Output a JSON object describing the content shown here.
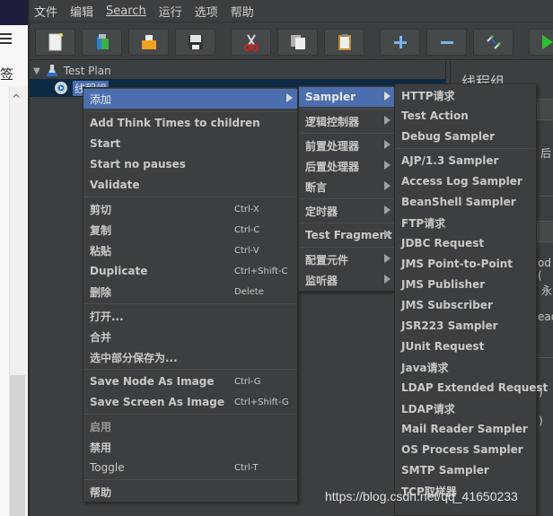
{
  "browser": {
    "side_char": "签",
    "scroll_up": "^"
  },
  "menubar": {
    "items": [
      "文件",
      "编辑",
      "Search",
      "运行",
      "选项",
      "帮助"
    ]
  },
  "toolbar": {
    "buttons": [
      "new",
      "templates",
      "open",
      "save",
      "cut",
      "copy",
      "paste",
      "expand",
      "collapse",
      "toggle",
      "start"
    ]
  },
  "tree": {
    "test_plan": "Test Plan",
    "thread_group": "线程组"
  },
  "right_panel": {
    "title": "线程组",
    "partial_texts": [
      "后",
      "od (",
      "永",
      "ead",
      ")",
      ")"
    ]
  },
  "context_menu": {
    "items": [
      {
        "label": "添加",
        "submenu": true,
        "selected": true
      },
      {
        "label": "Add Think Times to children"
      },
      {
        "label": "Start"
      },
      {
        "label": "Start no pauses"
      },
      {
        "label": "Validate"
      },
      {
        "label": "剪切",
        "shortcut": "Ctrl-X"
      },
      {
        "label": "复制",
        "shortcut": "Ctrl-C"
      },
      {
        "label": "粘贴",
        "shortcut": "Ctrl-V"
      },
      {
        "label": "Duplicate",
        "shortcut": "Ctrl+Shift-C"
      },
      {
        "label": "删除",
        "shortcut": "Delete"
      },
      {
        "label": "打开..."
      },
      {
        "label": "合并"
      },
      {
        "label": "选中部分保存为..."
      },
      {
        "label": "Save Node As Image",
        "shortcut": "Ctrl-G"
      },
      {
        "label": "Save Screen As Image",
        "shortcut": "Ctrl+Shift-G"
      },
      {
        "label": "启用"
      },
      {
        "label": "禁用"
      },
      {
        "label": "Toggle",
        "shortcut": "Ctrl-T"
      },
      {
        "label": "帮助"
      }
    ]
  },
  "add_submenu": {
    "items": [
      {
        "label": "Sampler",
        "selected": true
      },
      {
        "label": "逻辑控制器"
      },
      {
        "label": "前置处理器"
      },
      {
        "label": "后置处理器"
      },
      {
        "label": "断言"
      },
      {
        "label": "定时器"
      },
      {
        "label": "Test Fragment"
      },
      {
        "label": "配置元件"
      },
      {
        "label": "监听器"
      }
    ]
  },
  "sampler_submenu": {
    "items": [
      "HTTP请求",
      "Test Action",
      "Debug Sampler",
      "AJP/1.3 Sampler",
      "Access Log Sampler",
      "BeanShell Sampler",
      "FTP请求",
      "JDBC Request",
      "JMS Point-to-Point",
      "JMS Publisher",
      "JMS Subscriber",
      "JSR223 Sampler",
      "JUnit Request",
      "Java请求",
      "LDAP Extended Request",
      "LDAP请求",
      "Mail Reader Sampler",
      "OS Process Sampler",
      "SMTP Sampler",
      "TCP取样器"
    ]
  },
  "watermark": "https://blog.csdn.net/qq_41650233"
}
